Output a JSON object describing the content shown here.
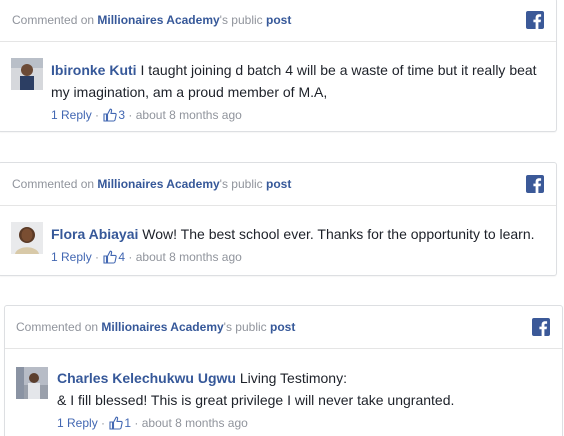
{
  "colors": {
    "link": "#365899",
    "muted": "#90949c",
    "facebook_blue": "#3b5998",
    "border": "#dddfe2"
  },
  "cards": [
    {
      "header": {
        "prefix": "Commented on ",
        "page_name": "Millionaires Academy",
        "suffix": "'s public ",
        "post_link": "post",
        "icon": "facebook-icon"
      },
      "author": "Ibironke Kuti",
      "text": " I taught joining d batch 4 will be a waste of time but it really beat my imagination, am a proud member of M.A,",
      "reply_label": "1 Reply",
      "like_count": "3",
      "time": "about 8 months ago"
    },
    {
      "header": {
        "prefix": "Commented on ",
        "page_name": "Millionaires Academy",
        "suffix": "'s public ",
        "post_link": "post",
        "icon": "facebook-icon"
      },
      "author": "Flora Abiayai",
      "text": " Wow! The best school ever. Thanks for the opportunity to learn.",
      "reply_label": "1 Reply",
      "like_count": "4",
      "time": "about 8 months ago"
    },
    {
      "header": {
        "prefix": "Commented on ",
        "page_name": "Millionaires Academy",
        "suffix": "'s public ",
        "post_link": "post",
        "icon": "facebook-icon"
      },
      "author": "Charles Kelechukwu Ugwu",
      "text": " Living Testimony:",
      "text_line2": "& I fill blessed! This is great privilege I will never take ungranted.",
      "reply_label": "1 Reply",
      "like_count": "1",
      "time": "about 8 months ago"
    }
  ]
}
